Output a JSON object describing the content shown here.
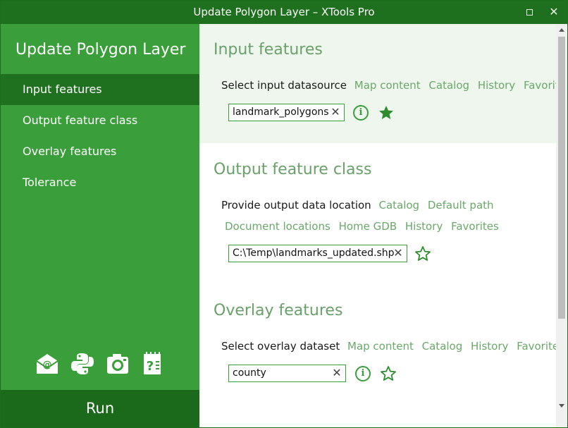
{
  "window": {
    "title": "Update Polygon Layer – XTools Pro"
  },
  "sidebar": {
    "title": "Update Polygon Layer",
    "items": [
      {
        "label": "Input features",
        "active": true
      },
      {
        "label": "Output feature class",
        "active": false
      },
      {
        "label": "Overlay features",
        "active": false
      },
      {
        "label": "Tolerance",
        "active": false
      }
    ],
    "tool_icons": [
      "email-icon",
      "python-icon",
      "camera-icon",
      "help-icon"
    ],
    "run_label": "Run"
  },
  "input_features": {
    "title": "Input features",
    "prompt": "Select input datasource",
    "links": [
      "Map content",
      "Catalog",
      "History",
      "Favorites"
    ],
    "value": "landmark_polygons",
    "favorite": true
  },
  "output_feature_class": {
    "title": "Output feature class",
    "prompt": "Provide output data location",
    "links_row1": [
      "Catalog",
      "Default path"
    ],
    "links_row2": [
      "Document locations",
      "Home GDB",
      "History",
      "Favorites"
    ],
    "value": "C:\\Temp\\landmarks_updated.shp",
    "favorite": false
  },
  "overlay_features": {
    "title": "Overlay features",
    "prompt": "Select overlay dataset",
    "links": [
      "Map content",
      "Catalog",
      "History",
      "Favorites"
    ],
    "value": "county",
    "favorite": false
  },
  "colors": {
    "sidebar": "#3a9e3a",
    "sidebar_active": "#1f701f",
    "titlebar": "#1e6f1e",
    "link": "#6aa86a",
    "section_title": "#6aa06a"
  }
}
